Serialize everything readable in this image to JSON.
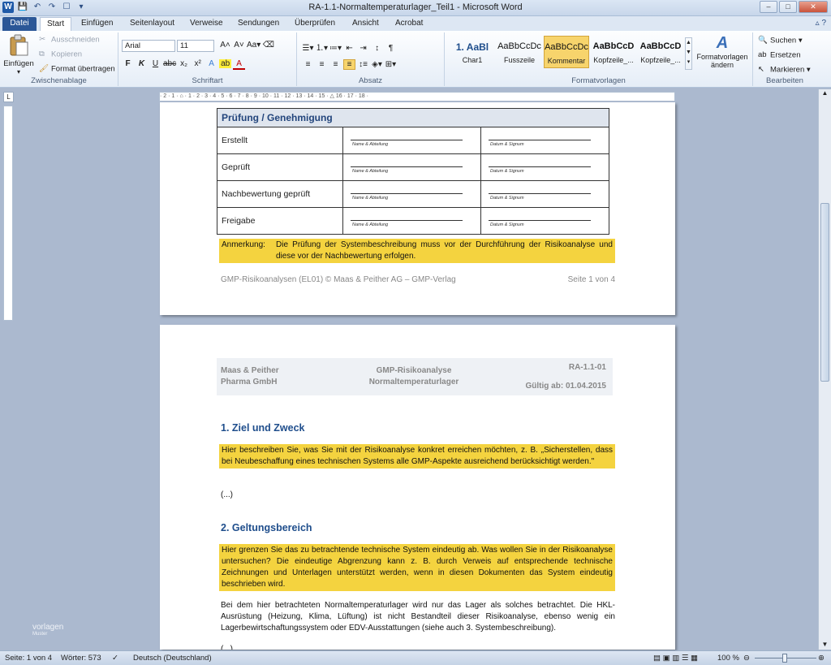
{
  "window": {
    "title": "RA-1.1-Normaltemperaturlager_Teil1  -  Microsoft Word",
    "qat": [
      "W",
      "💾",
      "↶",
      "↷",
      "☐",
      "▾"
    ]
  },
  "tabs": [
    "Datei",
    "Start",
    "Einfügen",
    "Seitenlayout",
    "Verweise",
    "Sendungen",
    "Überprüfen",
    "Ansicht",
    "Acrobat"
  ],
  "ribbon": {
    "clipboard": {
      "paste": "Einfügen",
      "cut": "Ausschneiden",
      "copy": "Kopieren",
      "format_painter": "Format übertragen",
      "label": "Zwischenablage"
    },
    "font": {
      "family": "Arial",
      "size": "11",
      "label": "Schriftart"
    },
    "paragraph": {
      "label": "Absatz"
    },
    "styles": {
      "items": [
        {
          "sample": "1. AaBl",
          "name": "Char1"
        },
        {
          "sample": "AaBbCcDc",
          "name": "Fusszeile"
        },
        {
          "sample": "AaBbCcDc",
          "name": "Kommentar"
        },
        {
          "sample": "AaBbCcD",
          "name": "Kopfzeile_..."
        },
        {
          "sample": "AaBbCcD",
          "name": "Kopfzeile_..."
        }
      ],
      "change": "Formatvorlagen ändern",
      "label": "Formatvorlagen"
    },
    "editing": {
      "find": "Suchen",
      "replace": "Ersetzen",
      "select": "Markieren",
      "label": "Bearbeiten"
    }
  },
  "ruler": "· 2 · 1 · ⌂ · 1 · 2 · 3 · 4 · 5 · 6 · 7 · 8 · 9 · 10 · 11 · 12 · 13 · 14 · 15 · △ 16 · 17 · 18 ·",
  "page1": {
    "table": {
      "title": "Prüfung / Genehmigung",
      "rows": [
        "Erstellt",
        "Geprüft",
        "Nachbewertung geprüft",
        "Freigabe"
      ],
      "cap_name": "Name & Abteilung",
      "cap_date": "Datum & Signum"
    },
    "note_key": "Anmerkung:",
    "note_text": "Die Prüfung der Systembeschreibung muss vor der Durchführung der Risikoanalyse und diese vor der Nachbewertung erfolgen.",
    "footer_left": "GMP-Risikoanalysen (EL01) © Maas & Peither AG – GMP-Verlag",
    "footer_right": "Seite 1 von 4"
  },
  "page2": {
    "header": {
      "company1": "Maas & Peither",
      "company2": "Pharma GmbH",
      "doc1": "GMP-Risikoanalyse",
      "doc2": "Normaltemperaturlager",
      "id": "RA-1.1-01",
      "valid": "Gültig ab: 01.04.2015"
    },
    "sec1_title": "1.   Ziel und Zweck",
    "sec1_hl": "Hier beschreiben Sie, was Sie mit der Risikoanalyse konkret erreichen möchten, z. B. „Sicherstellen, dass bei Neubeschaffung eines technischen Systems alle GMP-Aspekte ausreichend berücksichtigt werden.\"",
    "sec1_p": "(...)",
    "sec2_title": "2.   Geltungsbereich",
    "sec2_hl": "Hier grenzen Sie das zu betrachtende technische System eindeutig ab. Was wollen Sie in der Risikoanalyse untersuchen? Die eindeutige Abgrenzung kann z. B. durch Verweis auf entsprechende technische Zeichnungen und Unterlagen unterstützt werden, wenn in diesen Dokumenten das System eindeutig beschrieben wird.",
    "sec2_p": "Bei dem hier betrachteten Normaltemperaturlager wird nur das Lager als solches betrachtet. Die HKL-Ausrüstung (Heizung, Klima, Lüftung) ist nicht Bestandteil dieser Risikoanalyse, ebenso wenig ein Lagerbewirtschaftungssystem oder EDV-Ausstattungen (siehe auch 3. Systembeschreibung).",
    "sec2_p2": "(...)"
  },
  "status": {
    "page": "Seite: 1 von 4",
    "words": "Wörter: 573",
    "lang": "Deutsch (Deutschland)",
    "zoom": "100 %"
  },
  "watermark": {
    "line1": "vorlagen",
    "line2": "Muster"
  }
}
